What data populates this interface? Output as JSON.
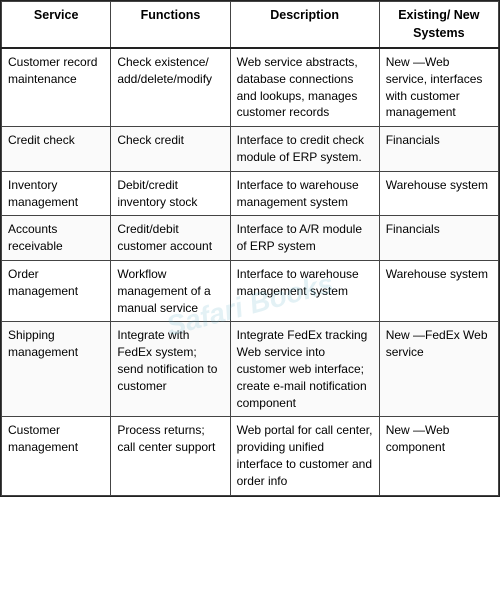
{
  "table": {
    "headers": {
      "service": "Service",
      "functions": "Functions",
      "description": "Description",
      "systems": "Existing/ New Systems"
    },
    "rows": [
      {
        "service": "Customer record maintenance",
        "functions": "Check existence/ add/delete/modify",
        "description": "Web service abstracts, database connections and lookups, manages customer records",
        "systems": "New —Web service, interfaces with customer management"
      },
      {
        "service": "Credit check",
        "functions": "Check credit",
        "description": "Interface to credit check module of ERP system.",
        "systems": "Financials"
      },
      {
        "service": "Inventory management",
        "functions": "Debit/credit inventory stock",
        "description": "Interface to warehouse management system",
        "systems": "Warehouse system"
      },
      {
        "service": "Accounts receivable",
        "functions": "Credit/debit customer account",
        "description": "Interface to A/R module of ERP system",
        "systems": "Financials"
      },
      {
        "service": "Order management",
        "functions": "Workflow management of a manual service",
        "description": "Interface to warehouse management system",
        "systems": "Warehouse system"
      },
      {
        "service": "Shipping management",
        "functions": "Integrate with FedEx system; send notification to customer",
        "description": "Integrate FedEx tracking Web service into customer web interface; create e-mail notification component",
        "systems": "New —FedEx Web service"
      },
      {
        "service": "Customer management",
        "functions": "Process returns; call center support",
        "description": "Web portal for call center, providing unified interface to customer and order info",
        "systems": "New —Web component"
      }
    ],
    "watermark": "Safari Books"
  }
}
